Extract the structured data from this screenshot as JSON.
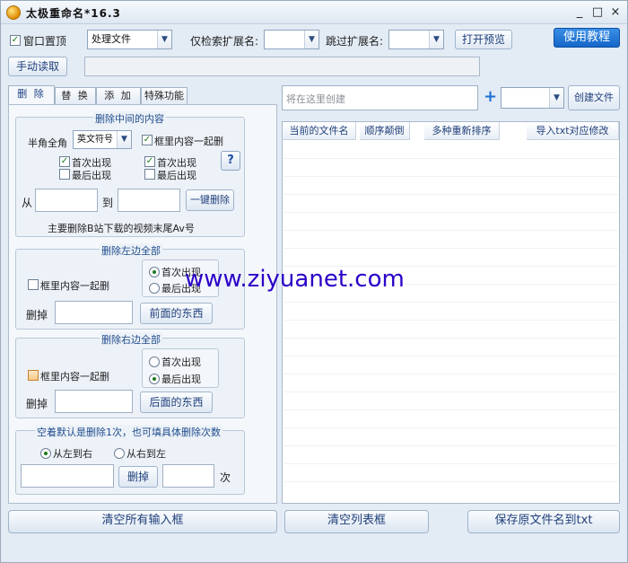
{
  "window": {
    "title": "太极重命名*16.3",
    "minimize": "_",
    "maximize": "□",
    "close": "×"
  },
  "toolbar": {
    "topmost_label": "窗口置顶",
    "mode_value": "处理文件",
    "only_ext_label": "仅检索扩展名:",
    "skip_ext_label": "跳过扩展名:",
    "open_preview": "打开预览",
    "tutorial": "使用教程",
    "manual_read": "手动读取"
  },
  "tabs": [
    {
      "label": "删 除"
    },
    {
      "label": "替 换"
    },
    {
      "label": "添 加"
    },
    {
      "label": "特殊功能"
    }
  ],
  "delete_middle": {
    "title": "删除中间的内容",
    "halfwidth_label": "半角全角",
    "halfwidth_value": "英文符号",
    "bracket_label": "框里内容一起删",
    "left_first": "首次出现",
    "left_last": "最后出现",
    "right_first": "首次出现",
    "right_last": "最后出现",
    "help": "?",
    "from_label": "从",
    "to_label": "到",
    "one_click": "一键删除",
    "note": "主要删除B站下载的视频末尾Av号"
  },
  "delete_left": {
    "title": "删除左边全部",
    "bracket_label": "框里内容一起删",
    "first": "首次出现",
    "last": "最后出现",
    "cut_label": "删掉",
    "action": "前面的东西"
  },
  "delete_right": {
    "title": "删除右边全部",
    "bracket_label": "框里内容一起删",
    "first": "首次出现",
    "last": "最后出现",
    "cut_label": "删掉",
    "action": "后面的东西"
  },
  "delete_count": {
    "title": "空着默认是删除1次，也可填具体删除次数",
    "ltr": "从左到右",
    "rtl": "从右到左",
    "action": "删掉",
    "times": "次"
  },
  "right_panel": {
    "create_placeholder": "将在这里创建",
    "plus": "+",
    "create_file": "创建文件",
    "columns": [
      "当前的文件名",
      "顺序颠倒",
      "多种重新排序",
      "导入txt对应修改"
    ]
  },
  "bottom": {
    "clear_inputs": "清空所有输入框",
    "clear_list": "清空列表框",
    "save_txt": "保存原文件名到txt"
  },
  "watermark": "www.ziyuanet.com",
  "colors": {
    "accent": "#1466c8",
    "check": "#1b7a1b",
    "watermark": "#2b00c8"
  }
}
